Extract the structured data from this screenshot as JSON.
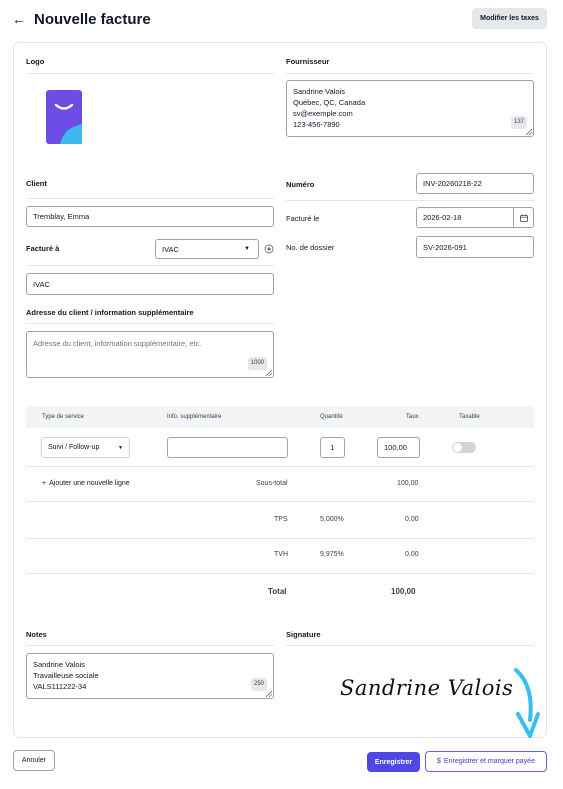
{
  "header": {
    "title": "Nouvelle facture",
    "back_icon": "arrow-left-icon",
    "modify_taxes_label": "Modifier les taxes"
  },
  "logo_section": {
    "label": "Logo",
    "logo_icon": "invoice-logo-icon",
    "colors": {
      "primary": "#6c4de6",
      "accent": "#3fb7f0"
    }
  },
  "supplier": {
    "label": "Fournisseur",
    "lines": [
      "Sandrine Valois",
      "Québec, QC, Canada",
      "sv@exemple.com",
      "123-456-7890"
    ],
    "counter": "137"
  },
  "client": {
    "label": "Client",
    "name_value": "Tremblay, Emma",
    "billed_to_label": "Facturé à",
    "billed_to_select": "IVAC",
    "billed_to_value": "IVAC",
    "address_label": "Adresse du client / information supplémentaire",
    "address_placeholder": "Adresse du client, information supplémentaire, etc.",
    "address_counter": "1000"
  },
  "invoice_meta": {
    "number_label": "Numéro",
    "number_value": "INV-20260218-22",
    "billed_on_label": "Facturé le",
    "billed_on_value": "2026-02-18",
    "file_label": "No. de dossier",
    "file_value": "SV-2026-091"
  },
  "table": {
    "headers": {
      "service_type": "Type de service",
      "extra_info": "Info. supplémentaire",
      "quantity": "Quantité",
      "rate": "Taux",
      "taxable": "Taxable"
    },
    "row": {
      "service": "Suivi / Follow-up",
      "extra_info": "",
      "quantity": "1",
      "rate": "100,00",
      "taxable": false
    },
    "add_line_label": "Ajouter une nouvelle ligne",
    "subtotal_label": "Sous-total",
    "subtotal_value": "100,00",
    "taxes": [
      {
        "name": "TPS",
        "rate": "5,000%",
        "amount": "0,00"
      },
      {
        "name": "TVH",
        "rate": "9,975%",
        "amount": "0,00"
      }
    ],
    "total_label": "Total",
    "total_value": "100,00"
  },
  "notes": {
    "label": "Notes",
    "lines": [
      "Sandrine Valois",
      "Travailleuse sociale",
      "VALS111222-34"
    ],
    "counter": "250"
  },
  "signature": {
    "label": "Signature",
    "text": "Sandrine Valois",
    "arrow_color": "#38bdf8"
  },
  "footer": {
    "cancel_label": "Annuler",
    "save_label": "Enregistrer",
    "save_paid_label": "Enregistrer et marquer payée"
  }
}
